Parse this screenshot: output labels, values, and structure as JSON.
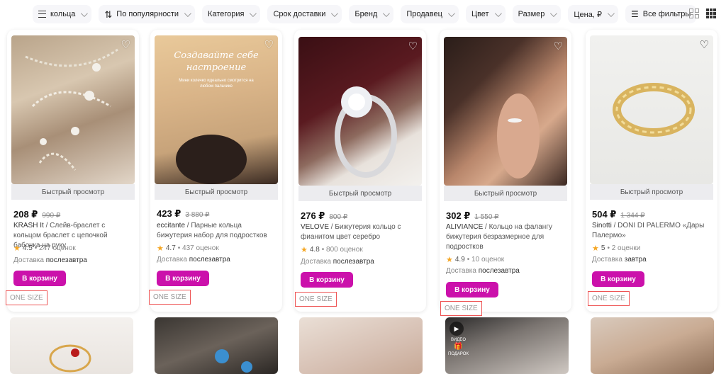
{
  "filters": {
    "query": "кольца",
    "sort": "По популярности",
    "category": "Категория",
    "delivery": "Срок доставки",
    "brand": "Бренд",
    "seller": "Продавец",
    "color": "Цвет",
    "size": "Размер",
    "price": "Цена, ₽",
    "all_filters": "Все фильтры"
  },
  "view_icons": [
    "grid-large-icon",
    "grid-small-icon"
  ],
  "colors": {
    "accent": "#cb11ab",
    "star": "#f5a623",
    "highlight": "#e55555"
  },
  "common": {
    "quick_view": "Быстрый просмотр",
    "add_to_cart": "В корзину",
    "size_tag": "ONE SIZE"
  },
  "products": [
    {
      "price": "208 ₽",
      "old_price": "990 ₽",
      "brand": "KRASH It",
      "name": " / Слейв-браслет с кольцом браслет с цепочкой бабочка на руку",
      "rating": "4.5",
      "reviews": "• 247 оценок",
      "delivery_label": "Доставка",
      "delivery_value": "послезавтра"
    },
    {
      "price": "423 ₽",
      "old_price": "3 880 ₽",
      "brand": "eccitante",
      "name": " / Парные кольца бижутерия набор для подростков",
      "rating": "4.7",
      "reviews": "• 437 оценок",
      "delivery_label": "Доставка",
      "delivery_value": "послезавтра",
      "image_text": "Создавайте себе настроение",
      "image_subtext": "Мини колечко идеально смотрится на любом пальчике"
    },
    {
      "price": "276 ₽",
      "old_price": "800 ₽",
      "brand": "VELOVE",
      "name": " / Бижутерия кольцо с фианитом цвет серебро",
      "rating": "4.8",
      "reviews": "• 800 оценок",
      "delivery_label": "Доставка",
      "delivery_value": "послезавтра"
    },
    {
      "price": "302 ₽",
      "old_price": "1 550 ₽",
      "brand": "ALIVIANCE",
      "name": " / Кольцо на фалангу бижутерия безразмерное для подростков",
      "rating": "4.9",
      "reviews": "• 10 оценок",
      "delivery_label": "Доставка",
      "delivery_value": "послезавтра"
    },
    {
      "price": "504 ₽",
      "old_price": "1 344 ₽",
      "brand": "Sinotti",
      "name": " / DONI DI PALERMO «Дары Палермо»",
      "rating": "5",
      "reviews": "• 2 оценки",
      "delivery_label": "Доставка",
      "delivery_value": "завтра"
    }
  ],
  "bottom_row": {
    "video_label": "ВИДЕО",
    "gift_label": "ПОДАРОК"
  }
}
